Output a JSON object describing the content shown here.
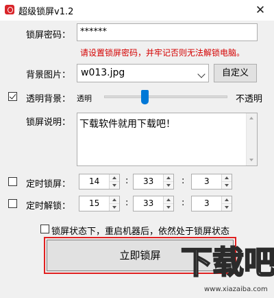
{
  "window": {
    "title": "超级锁屏v1.2",
    "close_glyph": "✕"
  },
  "password": {
    "label": "锁屏密码：",
    "value": "******"
  },
  "warning": "请设置锁屏密码，并牢记否则无法解锁电脑。",
  "background": {
    "label": "背景图片：",
    "selected": "w013.jpg",
    "custom_button": "自定义"
  },
  "transparency": {
    "label": "透明背景：",
    "checked": true,
    "left_label": "透明",
    "right_label": "不透明",
    "level_percent": 33
  },
  "description": {
    "label": "锁屏说明：",
    "text": "下载软件就用下载吧！"
  },
  "timed_lock": {
    "label": "定时锁屏：",
    "checked": false,
    "hour": "14",
    "minute": "33",
    "second": "3"
  },
  "timed_unlock": {
    "label": "定时解锁：",
    "checked": false,
    "hour": "15",
    "minute": "33",
    "second": "3"
  },
  "colon": ":",
  "persist_option": {
    "label": "锁屏状态下，重启机器后，依然处于锁屏状态",
    "checked": false
  },
  "lock_button": "立即锁屏",
  "watermark": {
    "logo_text": "下载吧",
    "url": "www.xiazaiba.com"
  },
  "colors": {
    "accent": "#0078d7",
    "warning": "#d40000",
    "highlight_border": "#e02020"
  }
}
